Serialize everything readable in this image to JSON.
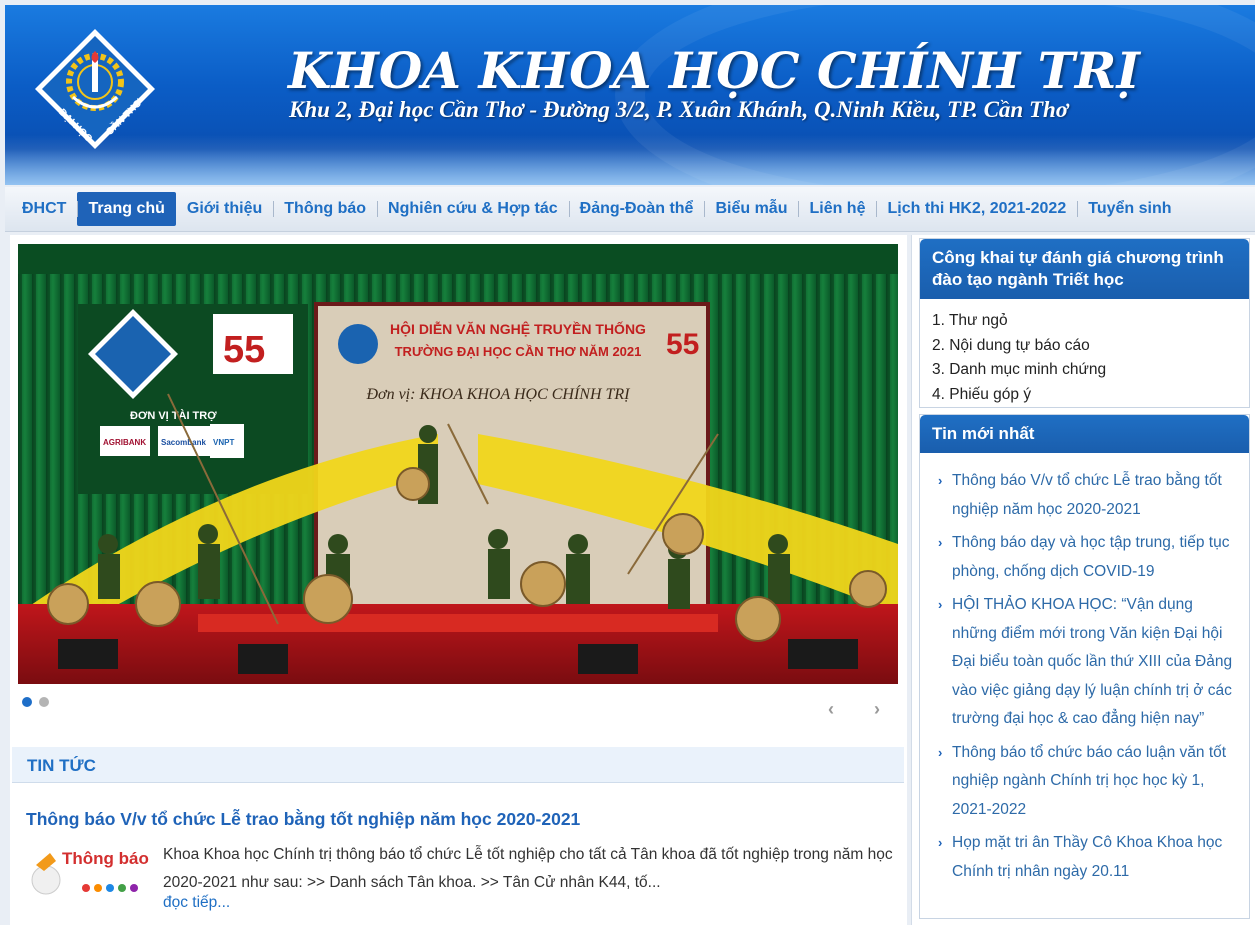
{
  "header": {
    "title": "KHOA KHOA HỌC CHÍNH TRỊ",
    "address": "Khu 2, Đại học Cần Thơ - Đường 3/2, P. Xuân Khánh, Q.Ninh Kiều, TP. Cần Thơ",
    "logo_text_left": "ĐẠI HỌC",
    "logo_text_right": "CẦN THƠ"
  },
  "nav": {
    "items": [
      {
        "label": "ĐHCT"
      },
      {
        "label": "Trang chủ"
      },
      {
        "label": "Giới thiệu"
      },
      {
        "label": "Thông báo"
      },
      {
        "label": "Nghiên cứu & Hợp tác"
      },
      {
        "label": "Đảng-Đoàn thể"
      },
      {
        "label": "Biểu mẫu"
      },
      {
        "label": "Liên hệ"
      },
      {
        "label": "Lịch thi HK2, 2021-2022"
      },
      {
        "label": "Tuyển sinh"
      }
    ],
    "active_index": 1
  },
  "slider": {
    "banner_line1": "HỘI DIỄN VĂN NGHỆ TRUYỀN THỐNG",
    "banner_line2": "TRƯỜNG ĐẠI HỌC CẦN THƠ NĂM 2021",
    "banner_unit": "Đơn vị: KHOA KHOA HỌC CHÍNH TRỊ",
    "anniversary": "55",
    "sponsor_label": "ĐƠN VỊ TÀI TRỢ",
    "sponsors": [
      "AGRIBANK",
      "Sacombank",
      "VNPT"
    ],
    "prev_arrow": "‹",
    "next_arrow": "›"
  },
  "news": {
    "section_title": "TIN TỨC",
    "title": "Thông báo V/v tổ chức Lễ trao bằng tốt nghiệp năm học 2020-2021",
    "thumb_text": "Thông báo",
    "excerpt": "Khoa Khoa học Chính trị thông báo tổ chức Lễ tốt nghiệp cho tất cả Tân khoa đã tốt nghiệp trong năm học 2020-2021 như sau: >> Danh sách Tân khoa. >> Tân Cử nhân K44, tố...",
    "read_more": "đọc tiếp..."
  },
  "sidebar": {
    "box1": {
      "title": "Công khai tự đánh giá chương trình đào tạo ngành Triết học",
      "items": [
        {
          "label": "1. Thư ngỏ"
        },
        {
          "label": "2. Nội dung tự báo cáo"
        },
        {
          "label": "3. Danh mục minh chứng"
        },
        {
          "label": "4. Phiếu góp ý"
        }
      ]
    },
    "box2": {
      "title": "Tin mới nhất",
      "items": [
        {
          "label": "Thông báo V/v tổ chức Lễ trao bằng tốt nghiệp năm học 2020-2021"
        },
        {
          "label": "Thông báo dạy và học tập trung, tiếp tục phòng, chống dịch COVID-19"
        },
        {
          "label": "HỘI THẢO KHOA HỌC: “Vận dụng những điểm mới trong Văn kiện Đại hội Đại biểu toàn quốc lần thứ XIII của Đảng vào việc giảng dạy lý luận chính trị ở các trường đại học & cao đẳng hiện nay”"
        },
        {
          "label": "Thông báo tổ chức báo cáo luận văn tốt nghiệp ngành Chính trị học học kỳ 1, 2021-2022"
        },
        {
          "label": "Họp mặt tri ân Thầy Cô Khoa Khoa học Chính trị nhân ngày 20.11"
        }
      ]
    }
  },
  "colors": {
    "brand_blue": "#1f63b8",
    "link_blue": "#1f6fc4",
    "header_blue": "#0b5dc6"
  }
}
